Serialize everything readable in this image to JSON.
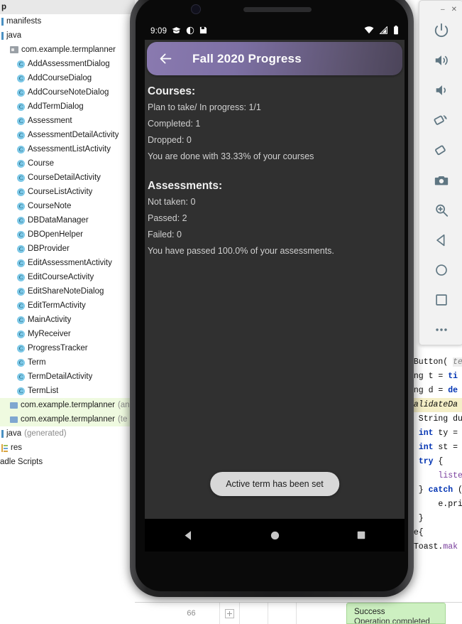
{
  "ide": {
    "project_tree": {
      "top_partial_label": "p",
      "items": [
        {
          "label": "manifests",
          "icon": "bar-icon",
          "indent": 1,
          "kind": "group"
        },
        {
          "label": "java",
          "icon": "bar-icon",
          "indent": 1,
          "kind": "group"
        },
        {
          "label": "com.example.termplanner",
          "icon": "package-icon",
          "indent": 2,
          "kind": "package"
        },
        {
          "label": "AddAssessmentDialog",
          "icon": "class-icon",
          "indent": 3,
          "kind": "class"
        },
        {
          "label": "AddCourseDialog",
          "icon": "class-icon",
          "indent": 3,
          "kind": "class"
        },
        {
          "label": "AddCourseNoteDialog",
          "icon": "class-icon",
          "indent": 3,
          "kind": "class"
        },
        {
          "label": "AddTermDialog",
          "icon": "class-icon",
          "indent": 3,
          "kind": "class"
        },
        {
          "label": "Assessment",
          "icon": "class-icon",
          "indent": 3,
          "kind": "class"
        },
        {
          "label": "AssessmentDetailActivity",
          "icon": "class-icon",
          "indent": 3,
          "kind": "class"
        },
        {
          "label": "AssessmentListActivity",
          "icon": "class-icon",
          "indent": 3,
          "kind": "class"
        },
        {
          "label": "Course",
          "icon": "class-icon",
          "indent": 3,
          "kind": "class"
        },
        {
          "label": "CourseDetailActivity",
          "icon": "class-icon",
          "indent": 3,
          "kind": "class"
        },
        {
          "label": "CourseListActivity",
          "icon": "class-icon",
          "indent": 3,
          "kind": "class"
        },
        {
          "label": "CourseNote",
          "icon": "class-icon",
          "indent": 3,
          "kind": "class"
        },
        {
          "label": "DBDataManager",
          "icon": "class-icon",
          "indent": 3,
          "kind": "class"
        },
        {
          "label": "DBOpenHelper",
          "icon": "class-icon",
          "indent": 3,
          "kind": "class"
        },
        {
          "label": "DBProvider",
          "icon": "class-icon",
          "indent": 3,
          "kind": "class"
        },
        {
          "label": "EditAssessmentActivity",
          "icon": "class-icon",
          "indent": 3,
          "kind": "class"
        },
        {
          "label": "EditCourseActivity",
          "icon": "class-icon",
          "indent": 3,
          "kind": "class"
        },
        {
          "label": "EditShareNoteDialog",
          "icon": "class-icon",
          "indent": 3,
          "kind": "class"
        },
        {
          "label": "EditTermActivity",
          "icon": "class-icon",
          "indent": 3,
          "kind": "class"
        },
        {
          "label": "MainActivity",
          "icon": "class-icon",
          "indent": 3,
          "kind": "class"
        },
        {
          "label": "MyReceiver",
          "icon": "class-icon",
          "indent": 3,
          "kind": "class"
        },
        {
          "label": "ProgressTracker",
          "icon": "class-icon",
          "indent": 3,
          "kind": "class"
        },
        {
          "label": "Term",
          "icon": "class-icon",
          "indent": 3,
          "kind": "class"
        },
        {
          "label": "TermDetailActivity",
          "icon": "class-icon",
          "indent": 3,
          "kind": "class"
        },
        {
          "label": "TermList",
          "icon": "class-icon",
          "indent": 3,
          "kind": "class"
        },
        {
          "label": "com.example.termplanner",
          "sub": "(an",
          "icon": "folder-icon",
          "indent": 2,
          "kind": "sourceset"
        },
        {
          "label": "com.example.termplanner",
          "sub": "(te",
          "icon": "folder-icon",
          "indent": 2,
          "kind": "sourceset"
        },
        {
          "label": "java",
          "sub": "(generated)",
          "icon": "bar-icon",
          "indent": 1,
          "kind": "group"
        },
        {
          "label": "res",
          "icon": "res-icon",
          "indent": 1,
          "kind": "group"
        },
        {
          "label": "adle Scripts",
          "icon": "none",
          "indent": 0,
          "kind": "group"
        }
      ]
    },
    "editor_code_right": [
      "eButton( te",
      "ing t = ti",
      "ing d = de",
      "validateDa",
      "  String du",
      "  int ty = ",
      "  int st = ",
      "  try {",
      "      liste",
      "  } catch (",
      "      e.pri",
      "  }",
      "se{",
      " Toast.mak"
    ],
    "status_strip": {
      "line_col": "66"
    },
    "notification": {
      "title": "Success",
      "body": "Operation completed"
    }
  },
  "emulator": {
    "window_controls": {
      "minimize": "–",
      "close": "✕"
    },
    "toolbar": [
      {
        "name": "power-icon",
        "label": "Power"
      },
      {
        "name": "volume-up-icon",
        "label": "Volume Up"
      },
      {
        "name": "volume-down-icon",
        "label": "Volume Down"
      },
      {
        "name": "rotate-left-icon",
        "label": "Rotate Left"
      },
      {
        "name": "rotate-right-icon",
        "label": "Rotate Right"
      },
      {
        "name": "camera-icon",
        "label": "Take Screenshot"
      },
      {
        "name": "zoom-icon",
        "label": "Zoom Mode"
      },
      {
        "name": "back-icon",
        "label": "Back"
      },
      {
        "name": "home-icon",
        "label": "Home"
      },
      {
        "name": "overview-icon",
        "label": "Overview"
      },
      {
        "name": "more-icon",
        "label": "More"
      }
    ],
    "device": {
      "statusbar": {
        "time": "9:09",
        "left_icons": [
          "graduation-cap-icon",
          "circle-progress-icon",
          "save-icon"
        ],
        "right_icons": [
          "wifi-icon",
          "signal-icon",
          "battery-icon"
        ]
      },
      "appbar": {
        "back_icon": "arrow-left-icon",
        "title": "Fall 2020 Progress",
        "gradient_from": "#8a7ab0",
        "gradient_to": "#4b4459"
      },
      "content": {
        "courses_heading": "Courses:",
        "courses_lines": [
          "Plan to take/ In progress: 1/1",
          "Completed: 1",
          "Dropped: 0",
          "You are done with 33.33% of your courses"
        ],
        "assessments_heading": "Assessments:",
        "assessments_lines": [
          "Not taken: 0",
          "Passed: 2",
          "Failed: 0",
          "You have passed 100.0% of your assessments."
        ]
      },
      "toast": "Active term has been set",
      "navbar": [
        {
          "name": "nav-back-icon",
          "label": "Back"
        },
        {
          "name": "nav-home-icon",
          "label": "Home"
        },
        {
          "name": "nav-recents-icon",
          "label": "Recents"
        }
      ]
    }
  }
}
